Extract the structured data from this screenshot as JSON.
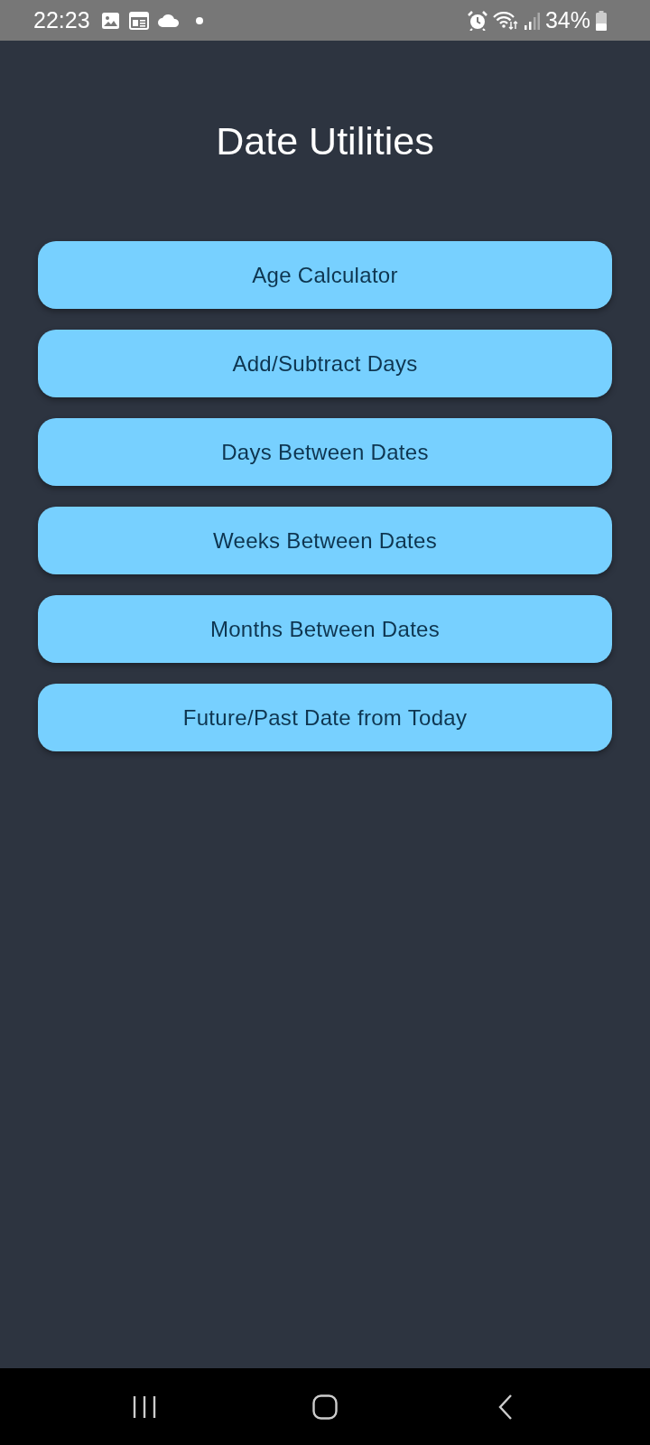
{
  "status_bar": {
    "time": "22:23",
    "battery": "34%"
  },
  "title": "Date Utilities",
  "buttons": [
    {
      "label": "Age Calculator"
    },
    {
      "label": "Add/Subtract Days"
    },
    {
      "label": "Days Between Dates"
    },
    {
      "label": "Weeks Between Dates"
    },
    {
      "label": "Months Between Dates"
    },
    {
      "label": "Future/Past Date from Today"
    }
  ]
}
